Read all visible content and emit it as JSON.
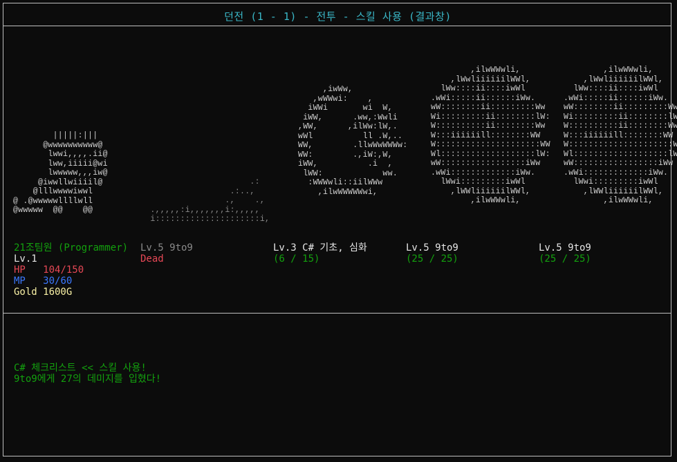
{
  "title": "던전 (1 - 1) - 전투 - 스킬 사용 (결과창)",
  "player": {
    "name": "21조팀원 (Programmer)",
    "level": "Lv.1",
    "hp_label": "HP",
    "hp_value": "104/150",
    "mp_label": "MP",
    "mp_value": "30/60",
    "gold": "Gold 1600G",
    "art": "        |||||:|||\n      @wwwwwwwwww@\n       lwwi,,,,.ii@\n       lww,iiiii@wi\n       lwwwww,,,iw@\n     @iwwllwiiiil@\n    @lllwwwwiwwl\n@ .@wwwwwllllwll\n@wwwww  @@    @@"
  },
  "enemies": [
    {
      "name": "Lv.5 9to9",
      "status": "Dead",
      "art": "                      .:\n                  .:..,\n                 .,    .,\n  .,,,,,:i,,,,,,,i:,,,,,\n  i:::::::::::::::::::::i,"
    },
    {
      "name": "Lv.3 C# 기초, 심화",
      "status": "(6 / 15)",
      "art": "          ,iwWw,\n        ,wWWwi:    ,\n       iWWi       wi  W,\n      iWW,      .ww,:Wwli\n     ,WW,      ,ilWw:lW,.\n     wWl          ll .W,..\n     WW,        .llwWwWWWw:\n     WW:        .,iW:,W,\n     iWW,          .i  ,\n      lWW:            ww.\n       :WWWwli::iilWWw\n         ,ilwWWWWWwi,"
    },
    {
      "name": "Lv.5 9to9",
      "status": "(25 / 25)",
      "art": "             ,ilwWWwli,\n         ,lWwliiiiiilWWl,\n       lWw::::ii::::iwWl\n     .wWi:::::ii::::::iWw.\n     wW::::::::ii:::::::::Ww\n     Wi:::::::::ii::::::::lW:\n     W::::::::::ii::::::::Ww\n     W:::iiiiiill::::::::WW\n     W:::::::::::::::::::::WW\n     Wl:::::::::::::::::::lW:\n     wW:::::::::::::::::iWw\n     .wWi:::::::::::::iWw.\n       lWwi:::::::::iwWl\n         ,lWWliiiiiilWWl,\n             ,ilwWWwli,"
    },
    {
      "name": "Lv.5 9to9",
      "status": "(25 / 25)",
      "art": "             ,ilwWWwli,\n         ,lWwliiiiiilWWl,\n       lWw::::ii::::iwWl\n     .wWi:::::ii::::::iWw.\n     wW::::::::ii:::::::::Ww\n     Wi:::::::::ii::::::::lW:\n     W::::::::::ii::::::::Ww\n     W:::iiiiiill::::::::WW\n     W:::::::::::::::::::::WW\n     Wl:::::::::::::::::::lW:\n     wW:::::::::::::::::iWw\n     .wWi:::::::::::::iWw.\n       lWwi:::::::::iwWl\n         ,lWWliiiiiilWWl,\n             ,ilwWWwli,"
    }
  ],
  "log": {
    "line1": "C# 체크리스트 << 스킬 사용!",
    "line2": "9to9에게 27의 데미지를 입혔다!"
  }
}
